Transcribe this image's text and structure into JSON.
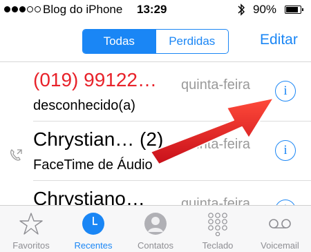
{
  "status_bar": {
    "carrier": "Blog do iPhone",
    "time": "13:29",
    "battery": "90%"
  },
  "nav": {
    "segments": [
      "Todas",
      "Perdidas"
    ],
    "active_segment": "Todas",
    "edit": "Editar"
  },
  "calls": [
    {
      "name": "(019) 99122…",
      "subtitle": "desconhecido(a)",
      "date": "quinta-feira",
      "missed": true,
      "facetime": false
    },
    {
      "name": "Chrystian…  (2)",
      "subtitle": "FaceTime de Áudio",
      "date": "quinta-feira",
      "missed": false,
      "facetime": true
    },
    {
      "name": "Chrystiano…",
      "subtitle": "",
      "date": "quinta-feira",
      "missed": false,
      "facetime": false
    }
  ],
  "info_glyph": "i",
  "tabs": [
    {
      "label": "Favoritos",
      "icon": "star-icon",
      "active": false
    },
    {
      "label": "Recentes",
      "icon": "clock-icon",
      "active": true
    },
    {
      "label": "Contatos",
      "icon": "contact-icon",
      "active": false
    },
    {
      "label": "Teclado",
      "icon": "keypad-icon",
      "active": false
    },
    {
      "label": "Voicemail",
      "icon": "voicemail-icon",
      "active": false
    }
  ],
  "colors": {
    "accent": "#1a86f5",
    "missed": "#e8222a",
    "arrow": "#e02020"
  }
}
